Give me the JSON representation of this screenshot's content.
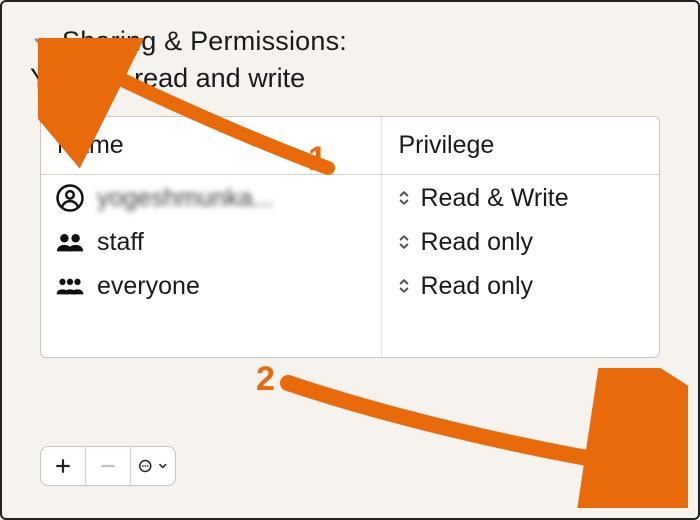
{
  "section": {
    "title": "Sharing & Permissions:"
  },
  "status": "You can read and write",
  "columns": {
    "name": "Name",
    "privilege": "Privilege"
  },
  "rows": [
    {
      "name": "yogeshmunka...",
      "privilege": "Read & Write",
      "icon": "user",
      "obscured": true
    },
    {
      "name": "staff",
      "privilege": "Read only",
      "icon": "group",
      "obscured": false
    },
    {
      "name": "everyone",
      "privilege": "Read only",
      "icon": "group",
      "obscured": false
    }
  ],
  "footer": {
    "add_label": "+",
    "remove_label": "−",
    "more_label": "…"
  },
  "annotations": {
    "one": "1",
    "two": "2"
  }
}
